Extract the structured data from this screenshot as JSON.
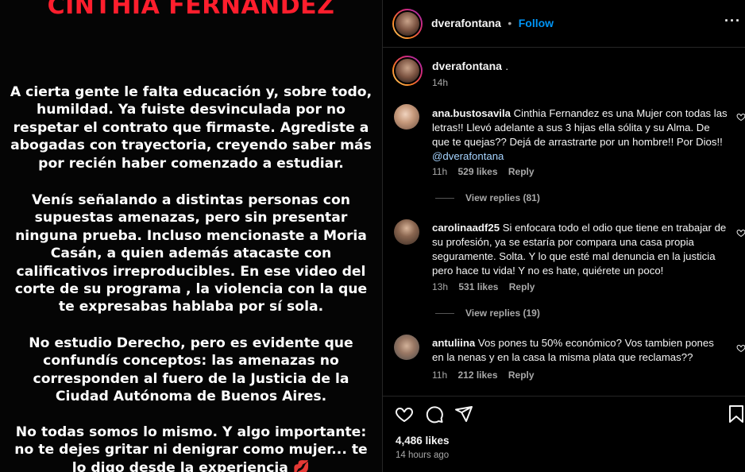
{
  "post": {
    "title": "CINTHIA FERNANDEZ",
    "paragraphs": [
      "A cierta gente le falta educación y, sobre todo, humildad. Ya fuiste desvinculada por no respetar el contrato que firmaste. Agrediste a abogadas con trayectoria, creyendo saber más por recién haber comenzado a estudiar.",
      "Venís señalando a distintas personas con supuestas amenazas, pero sin presentar ninguna prueba. Incluso mencionaste a Moria Casán, a quien además atacaste con calificativos irreproducibles. En ese video del corte de su programa , la violencia con la que te expresabas hablaba por sí sola.",
      "No estudio Derecho, pero es evidente que confundís conceptos: las amenazas no corresponden al fuero de la Justicia de la Ciudad Autónoma de Buenos Aires.",
      "No todas somos lo mismo. Y algo importante: no te dejes gritar ni denigrar como mujer... te lo digo desde la experiencia"
    ],
    "kiss_emoji": "💋"
  },
  "header": {
    "username": "dverafontana",
    "separator": "•",
    "follow_label": "Follow",
    "more_label": "···"
  },
  "caption": {
    "username": "dverafontana",
    "text": ".",
    "time": "14h"
  },
  "comments": [
    {
      "username": "ana.bustosavila",
      "text": "Cinthia Fernandez es una Mujer con todas las letras!! Llevó adelante a sus 3 hijas ella sólita y su Alma. De que te quejas?? Dejá de arrastrarte por un hombre!! Por Dios!!",
      "mention": "@dverafontana",
      "time": "11h",
      "likes": "529 likes",
      "reply": "Reply",
      "view_replies": "View replies (81)"
    },
    {
      "username": "carolinaadf25",
      "text": "Si enfocara todo el odio que tiene en trabajar de su profesión, ya se estaría por compara una casa propia seguramente. Solta. Y lo que esté mal denuncia en la justicia pero hace tu vida! Y no es hate, quiérete un poco!",
      "mention": "",
      "time": "13h",
      "likes": "531 likes",
      "reply": "Reply",
      "view_replies": "View replies (19)"
    },
    {
      "username": "antuliina",
      "text": "Vos pones tu 50% económico? Vos tambien pones en la nenas y en la casa la misma plata que reclamas??",
      "mention": "",
      "time": "11h",
      "likes": "212 likes",
      "reply": "Reply",
      "view_replies": ""
    }
  ],
  "footer": {
    "likes": "4,486 likes",
    "time": "14 hours ago"
  },
  "colors": {
    "title_red": "#ff1e2d",
    "follow_blue": "#0095f6",
    "background": "#000000"
  }
}
